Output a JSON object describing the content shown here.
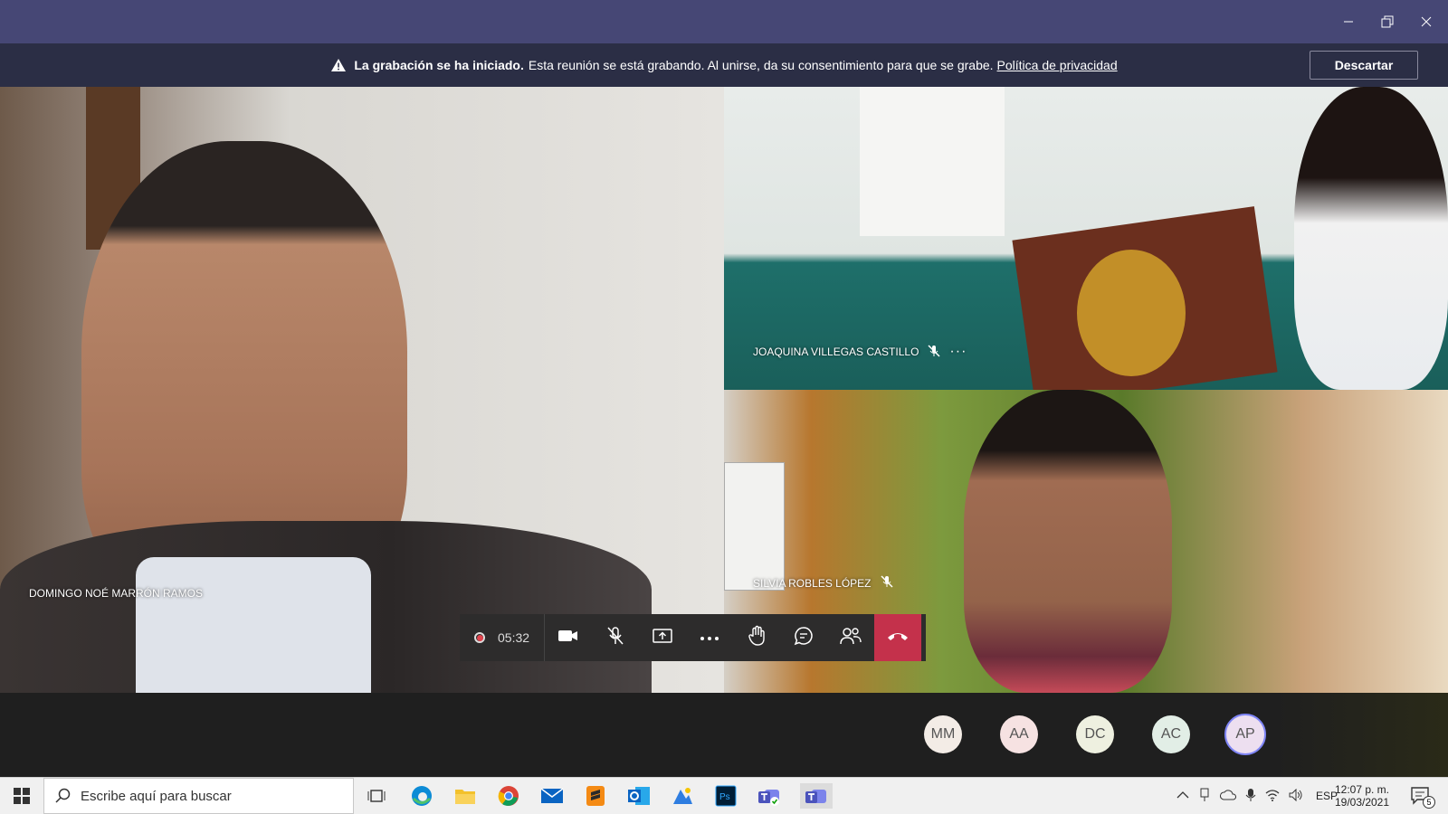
{
  "banner": {
    "bold": "La grabación se ha iniciado.",
    "text": "Esta reunión se está grabando. Al unirse, da su consentimiento para que se grabe.",
    "link": "Política de privacidad",
    "dismiss": "Descartar"
  },
  "participants": [
    {
      "name": "DOMINGO NOÉ MARRÓN RAMOS"
    },
    {
      "name": "JOAQUINA VILLEGAS CASTILLO",
      "muted": true
    },
    {
      "name": "SILVIA ROBLES LÓPEZ",
      "muted": true
    }
  ],
  "controls": {
    "timer": "05:32"
  },
  "avatars": [
    {
      "initials": "MM",
      "bg": "#f3ece6"
    },
    {
      "initials": "AA",
      "bg": "#f6e2e2"
    },
    {
      "initials": "DC",
      "bg": "#eef0e0"
    },
    {
      "initials": "AC",
      "bg": "#e2eee6"
    },
    {
      "initials": "AP",
      "bg": "#eddff0"
    }
  ],
  "taskbar": {
    "search_placeholder": "Escribe aquí para buscar",
    "language": "ESP",
    "time": "12:07 p. m.",
    "date": "19/03/2021",
    "notifications": "5"
  },
  "colors": {
    "title_bar": "#464775",
    "banner": "#2b2e45",
    "hangup": "#c4314b"
  }
}
